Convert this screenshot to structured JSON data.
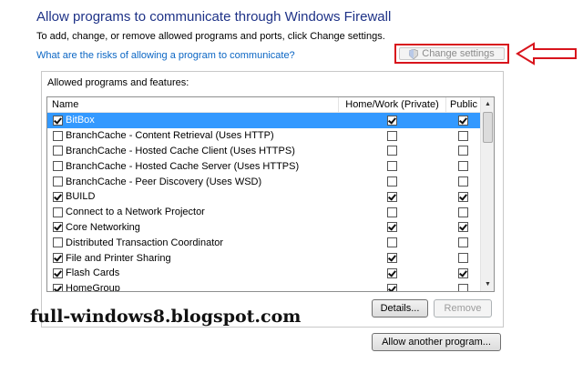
{
  "header": {
    "title": "Allow programs to communicate through Windows Firewall",
    "subtitle": "To add, change, or remove allowed programs and ports, click Change settings.",
    "risk_link": "What are the risks of allowing a program to communicate?",
    "change_settings_label": "Change settings"
  },
  "group": {
    "label": "Allowed programs and features:",
    "columns": {
      "name": "Name",
      "home": "Home/Work (Private)",
      "public": "Public"
    },
    "rows": [
      {
        "name": "BitBox",
        "enabled": true,
        "home": true,
        "public": true,
        "selected": true
      },
      {
        "name": "BranchCache - Content Retrieval (Uses HTTP)",
        "enabled": false,
        "home": false,
        "public": false
      },
      {
        "name": "BranchCache - Hosted Cache Client (Uses HTTPS)",
        "enabled": false,
        "home": false,
        "public": false
      },
      {
        "name": "BranchCache - Hosted Cache Server (Uses HTTPS)",
        "enabled": false,
        "home": false,
        "public": false
      },
      {
        "name": "BranchCache - Peer Discovery (Uses WSD)",
        "enabled": false,
        "home": false,
        "public": false
      },
      {
        "name": "BUILD",
        "enabled": true,
        "home": true,
        "public": true
      },
      {
        "name": "Connect to a Network Projector",
        "enabled": false,
        "home": false,
        "public": false
      },
      {
        "name": "Core Networking",
        "enabled": true,
        "home": true,
        "public": true
      },
      {
        "name": "Distributed Transaction Coordinator",
        "enabled": false,
        "home": false,
        "public": false
      },
      {
        "name": "File and Printer Sharing",
        "enabled": true,
        "home": true,
        "public": false
      },
      {
        "name": "Flash Cards",
        "enabled": true,
        "home": true,
        "public": true
      },
      {
        "name": "HomeGroup",
        "enabled": true,
        "home": true,
        "public": false
      }
    ]
  },
  "buttons": {
    "details": "Details...",
    "remove": "Remove",
    "allow_another": "Allow another program..."
  },
  "watermark": "full-windows8.blogspot.com",
  "colors": {
    "title": "#1e3287",
    "link": "#0b66c4",
    "highlight_box": "#d8141c",
    "selected_row": "#3399ff"
  },
  "icons": {
    "shield": "uac-shield-icon",
    "arrow": "left-arrow-icon"
  }
}
